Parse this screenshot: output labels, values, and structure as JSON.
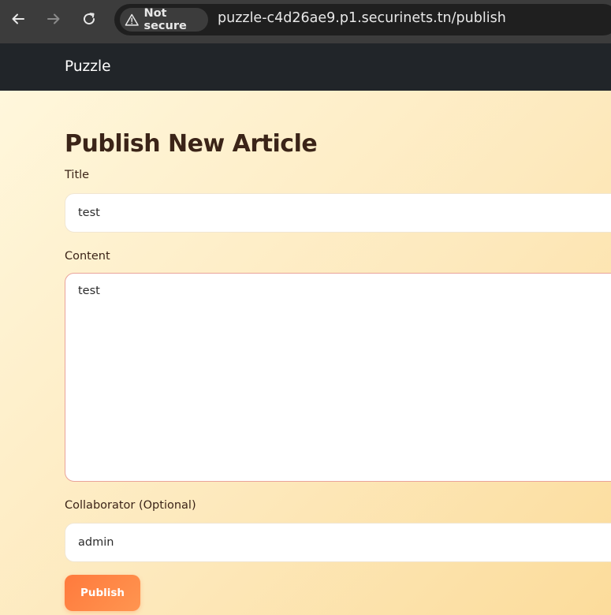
{
  "browser": {
    "security_label": "Not secure",
    "url": "puzzle-c4d26ae9.p1.securinets.tn/publish"
  },
  "navbar": {
    "brand": "Puzzle"
  },
  "form": {
    "heading": "Publish New Article",
    "title_label": "Title",
    "title_value": "test",
    "content_label": "Content",
    "content_value": "test",
    "collaborator_label": "Collaborator (Optional)",
    "collaborator_value": "admin",
    "submit_label": "Publish"
  },
  "colors": {
    "navbar_bg": "#212529",
    "accent": "#ff7a3d",
    "heading": "#3b2418"
  }
}
